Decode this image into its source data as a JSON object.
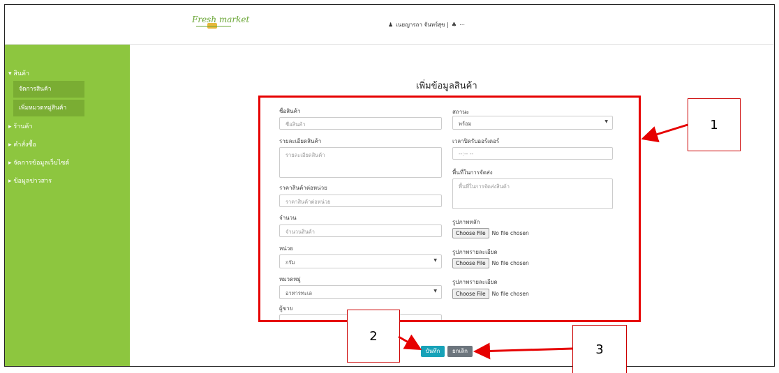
{
  "header": {
    "logo_text": "Fresh market",
    "user_name": "เนยญารถา จันทร์สุข |",
    "more": "⋯"
  },
  "sidebar": {
    "items": [
      {
        "label": "▾ สินค้า"
      },
      {
        "label": "จัดการสินค้า"
      },
      {
        "label": "เพิ่มหมวดหมู่สินค้า"
      },
      {
        "label": "▸ ร้านค้า"
      },
      {
        "label": "▸ คำสั่งซื้อ"
      },
      {
        "label": "▸ จัดการข้อมูลเว็บไซต์"
      },
      {
        "label": "▸ ข้อมูลข่าวสาร"
      }
    ]
  },
  "form": {
    "title": "เพิ่มข้อมูลสินค้า",
    "name_label": "ชื่อสินค้า",
    "name_placeholder": "ชื่อสินค้า",
    "detail_label": "รายละเอียดสินค้า",
    "detail_placeholder": "รายละเอียดสินค้า",
    "price_label": "ราคาสินค้าต่อหน่วย",
    "price_placeholder": "ราคาสินค้าต่อหน่วย",
    "qty_label": "จำนวน",
    "qty_placeholder": "จำนวนสินค้า",
    "unit_label": "หน่วย",
    "unit_value": "กรัม",
    "category_label": "หมวดหมู่",
    "category_value": "อาหารทะเล",
    "seller_label": "ผู้ขาย",
    "seller_value": "",
    "status_label": "สถานะ",
    "status_value": "พร้อม",
    "closing_label": "เวลาปิดรับออร์เดอร์",
    "closing_placeholder": "--:-- --",
    "area_label": "พื้นที่ในการจัดส่ง",
    "area_placeholder": "พื้นที่ในการจัดส่งสินค้า",
    "main_image_label": "รูปภาพหลัก",
    "detail_image_label_1": "รูปภาพรายละเอียด",
    "detail_image_label_2": "รูปภาพรายละเอียด",
    "choose_file": "Choose File",
    "no_file": "No file chosen",
    "save_button": "บันทึก",
    "cancel_button": "ยกเลิก"
  },
  "annotations": {
    "callout_1": "1",
    "callout_2": "2",
    "callout_3": "3",
    "highlight_color": "#e60000"
  }
}
